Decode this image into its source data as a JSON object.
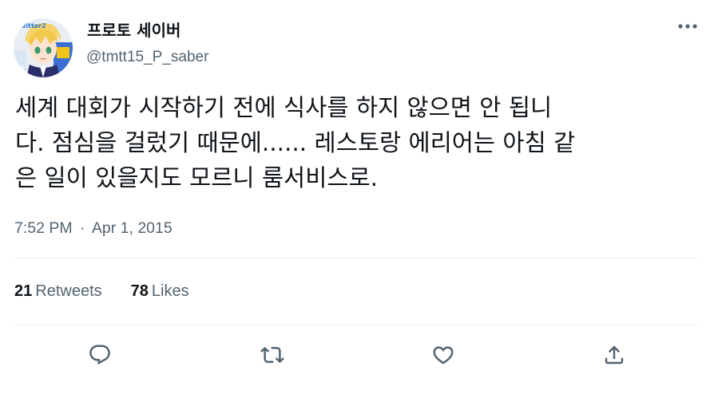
{
  "author": {
    "display_name": "프로토 세이버",
    "handle": "@tmtt15_P_saber",
    "avatar_icon": "profile-avatar-anime-character"
  },
  "tweet": {
    "text": "세계 대회가 시작하기 전에 식사를 하지 않으면 안 됩니\n다. 점심을 걸렀기 때문에...... 레스토랑 에리어는 아침 같\n은 일이 있을지도 모르니 룸서비스로."
  },
  "meta": {
    "time": "7:52 PM",
    "separator": "·",
    "date": "Apr 1, 2015"
  },
  "stats": {
    "retweets_count": "21",
    "retweets_label": "Retweets",
    "likes_count": "78",
    "likes_label": "Likes"
  },
  "actions": {
    "reply_icon": "reply-icon",
    "retweet_icon": "retweet-icon",
    "like_icon": "heart-icon",
    "share_icon": "share-icon",
    "more_icon": "more-dots-icon"
  },
  "colors": {
    "text_primary": "#0f1419",
    "text_secondary": "#536471",
    "divider": "#eff3f4"
  }
}
